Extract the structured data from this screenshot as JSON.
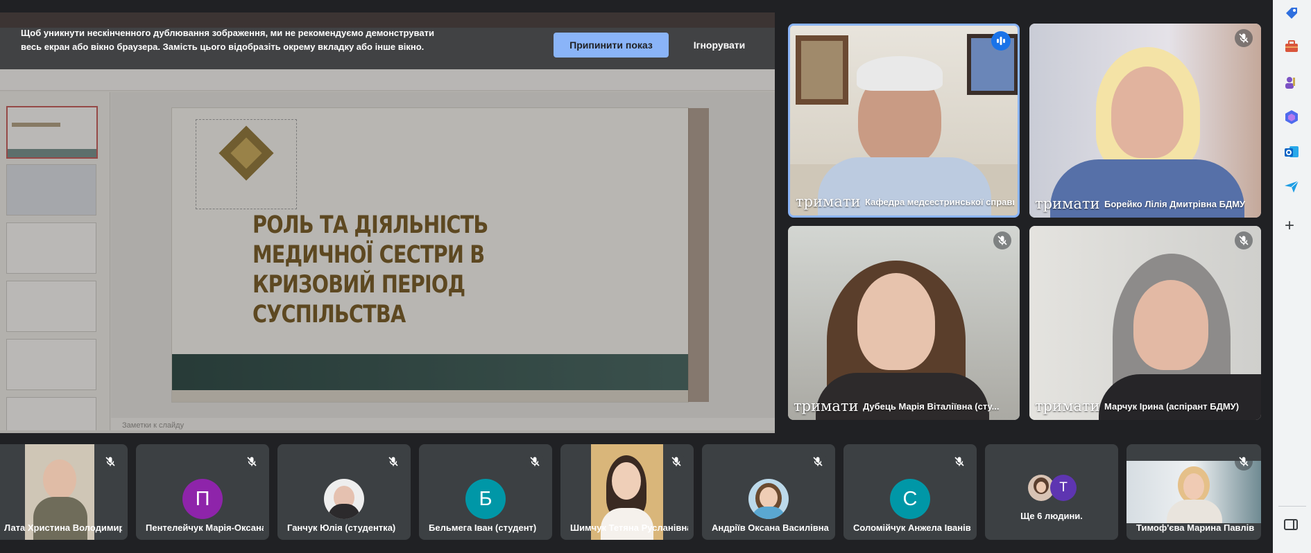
{
  "banner": {
    "text": "Щоб уникнути нескінченного дублювання зображення, ми не рекомендуємо демонструвати весь екран або вікно браузера. Замість цього відобразіть окрему вкладку або інше вікно.",
    "stop_label": "Припинити показ",
    "ignore_label": "Ігнорувати"
  },
  "slide": {
    "title": "РОЛЬ ТА ДІЯЛЬНІСТЬ МЕДИЧНОЇ СЕСТРИ В КРИЗОВИЙ ПЕРІОД СУСПІЛЬСТВА",
    "notes_placeholder": "Заметки к слайду"
  },
  "hold_label": "тримати",
  "main_tiles": [
    {
      "name": "Кафедра медсестринської справи...",
      "speaking": true
    },
    {
      "name": "Борейко Лілія Дмитрівна БДМУ",
      "speaking": false
    },
    {
      "name": "Дубець Марія Віталіївна (сту...",
      "speaking": false
    },
    {
      "name": "Марчук Ірина (аспірант БДМУ)",
      "speaking": false
    }
  ],
  "strip": [
    {
      "name": "Лата Христина Володимирівна",
      "avatar": "photo"
    },
    {
      "name": "Пентелейчук Марія-Оксана",
      "avatar": "letter",
      "letter": "П",
      "color": "#8e24aa"
    },
    {
      "name": "Ганчук Юлія (студентка)",
      "avatar": "photo"
    },
    {
      "name": "Бельмега Іван (студент)",
      "avatar": "letter",
      "letter": "Б",
      "color": "#0097a7"
    },
    {
      "name": "Шимчук Тетяна Русланівна",
      "avatar": "photo"
    },
    {
      "name": "Андріїв Оксана Василівна",
      "avatar": "photo"
    },
    {
      "name": "Соломійчук Анжела Іванівна",
      "avatar": "letter",
      "letter": "С",
      "color": "#0097a7"
    },
    {
      "name": "Ще 6 людини.",
      "avatar": "group",
      "letter": "T",
      "color": "#5e35b1"
    },
    {
      "name": "Тимоф'єва Марина Павлівна",
      "avatar": "video"
    }
  ],
  "sidebar": {
    "icons": [
      "tag-icon",
      "briefcase-icon",
      "people-icon",
      "copilot-icon",
      "outlook-icon",
      "send-icon"
    ],
    "add_label": "+"
  }
}
